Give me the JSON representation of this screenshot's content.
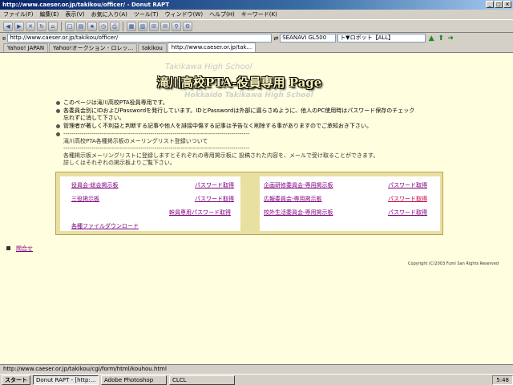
{
  "window": {
    "title": "http://www.caeser.or.jp/takikou/officer/ - Donut RAPT"
  },
  "menu": [
    "ファイル(F)",
    "編集(E)",
    "表示(V)",
    "お気に入り(A)",
    "ツール(T)",
    "ウィンドウ(W)",
    "ヘルプ(H)",
    "キーワード(K)"
  ],
  "address": {
    "url": "http://www.caeser.or.jp/takikou/officer/",
    "search_engine": "SEANAVI GL500",
    "robot": "ト▼ロボット【ALL】"
  },
  "tabs": [
    "Yahoo! JAPAN",
    "Yahoo!オークション - ロレッ...",
    "takikou",
    "http://www.caeser.or.jp/tak..."
  ],
  "banner": {
    "ghost": "Takikawa High School",
    "title": "滝川高校PTA-役員専用 Page",
    "sub": "Hokkaido Takikawa High School"
  },
  "notices": [
    "このページは滝川高校PTA役員専用です。",
    "各委員会別にIDおよびPasswordを発行しています。IDとPasswordは外部に漏らさぬように、他人のPC使用時はパスワード保存のチェック\n忘れずに消して下さい。",
    "管理者が著しく不利益と判断する記事や他人を誹謗中傷する記事は予告なく削除する事がありますのでご承知おき下さい。",
    "--------------------------------------------------------------------------------------------\n滝川高校PTA各種掲示板のメーリングリスト登録いついて\n--------------------------------------------------------------------------------------------\n各種掲示板メーリングリストに登録しますとそれぞれの専用掲示板に 投稿された内容を、メールで受け取ることができます。\n詳しくはそれぞれの掲示板よりご覧下さい。"
  ],
  "boards": {
    "left": [
      {
        "name": "役員会-総会掲示板",
        "pw": "パスワード取得"
      },
      {
        "name": "三役掲示板",
        "pw": "パスワード取得"
      },
      {
        "name": "",
        "pw": "幹員専用パスワード取得"
      },
      {
        "name": "各種ファイルダウンロード",
        "pw": ""
      }
    ],
    "right": [
      {
        "name": "企画研修委員会-専用掲示板",
        "pw": "パスワード取得"
      },
      {
        "name": "広報委員会-専用掲示板",
        "pw": "パスワード取得"
      },
      {
        "name": "校外生活委員会-専用掲示板",
        "pw": "パスワード取得"
      }
    ]
  },
  "contact": "問合せ",
  "copyright": "Copyright (C)2003 Fumi San Rights Reserved",
  "status": "http://www.caeser.or.jp/takikou/cgi/form/html/kouhou.html",
  "taskbar": {
    "start": "スタート",
    "tasks": [
      "Donut RAPT - [http:...",
      "Adobe Photoshop",
      "CLCL"
    ],
    "clock": "5:48"
  }
}
